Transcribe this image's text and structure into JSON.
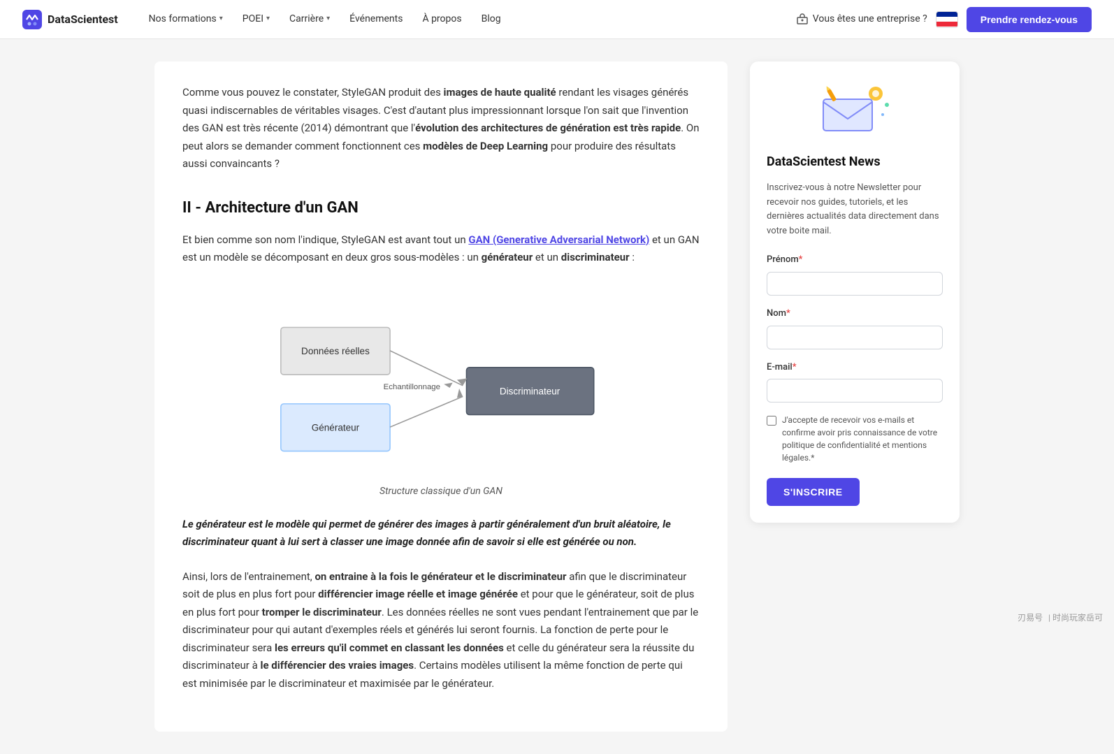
{
  "navbar": {
    "logo_text": "DataScientest",
    "nav_items": [
      {
        "label": "Nos formations",
        "has_dropdown": true
      },
      {
        "label": "POEI",
        "has_dropdown": true
      },
      {
        "label": "Carrière",
        "has_dropdown": true
      },
      {
        "label": "Événements",
        "has_dropdown": false
      },
      {
        "label": "À propos",
        "has_dropdown": false
      },
      {
        "label": "Blog",
        "has_dropdown": false
      }
    ],
    "enterprise_label": "Vous êtes une entreprise ?",
    "cta_label": "Prendre rendez-vous"
  },
  "article": {
    "intro_text_1": "Comme vous pouvez le constater, StyleGAN produit des ",
    "intro_bold_1": "images de haute qualité",
    "intro_text_2": " rendant les visages générés quasi indiscernables de véritables visages. C'est d'autant plus impressionnant lorsque l'on sait que l'invention des GAN est très récente (2014) démontrant que l'",
    "intro_bold_2": "évolution des architectures de génération est très rapide",
    "intro_text_3": ". On peut alors se demander comment fonctionnent ces ",
    "intro_bold_3": "modèles de Deep Learning",
    "intro_text_4": " pour produire des résultats aussi convaincants ?",
    "section_heading": "II - Architecture d'un GAN",
    "section_intro_1": "Et bien comme son nom l'indique, StyleGAN est avant tout un ",
    "section_link": "GAN (Generative Adversarial Network)",
    "section_intro_2": " et un GAN est un modèle se décomposant en deux gros sous-modèles : un ",
    "section_bold_1": "générateur",
    "section_intro_3": " et un ",
    "section_bold_2": "discriminateur",
    "section_intro_4": " :",
    "diagram_caption": "Structure classique d'un GAN",
    "diagram_labels": {
      "donnees_reelles": "Données réelles",
      "generateur": "Générateur",
      "echantillonnage": "Echantillonnage",
      "discriminateur": "Discriminateur"
    },
    "blockquote": "Le générateur est le modèle qui permet de générer des images à partir généralement d'un bruit aléatoire, le discriminateur quant à lui sert à classer une image donnée afin de savoir si elle est générée ou non.",
    "body_1": "Ainsi, lors de l'entrainement, ",
    "body_bold_1": "on entraine à la fois le générateur et le discriminateur",
    "body_2": " afin que le discriminateur soit de plus en plus fort pour ",
    "body_bold_2": "différencier image réelle et image générée",
    "body_3": " et pour que le générateur, soit de plus en plus fort pour ",
    "body_bold_3": "tromper le discriminateur",
    "body_4": ". Les données réelles ne sont vues pendant l'entrainement que par le discriminateur pour qui autant d'exemples réels et générés lui seront fournis. La fonction de perte pour le discriminateur sera ",
    "body_bold_4": "les erreurs qu'il commet en classant les données",
    "body_5": " et celle du générateur sera la réussite du discriminateur à ",
    "body_bold_5": "le différencier des vraies images",
    "body_6": ". Certains modèles utilisent la même fonction de perte qui est minimisée par le discriminateur et maximisée par le générateur."
  },
  "sidebar": {
    "title": "DataScientest News",
    "description": "Inscrivez-vous à notre Newsletter pour recevoir nos guides, tutoriels, et les dernières actualités data directement dans votre boite mail.",
    "form": {
      "prenom_label": "Prénom",
      "prenom_required": "*",
      "prenom_placeholder": "",
      "nom_label": "Nom",
      "nom_required": "*",
      "nom_placeholder": "",
      "email_label": "E-mail",
      "email_required": "*",
      "email_placeholder": "",
      "checkbox_text": "J'accepte de recevoir vos e-mails et confirme avoir pris connaissance de votre politique de confidentialité et mentions légales.",
      "checkbox_required": "*",
      "subscribe_label": "S'INSCRIRE"
    }
  },
  "watermark": {
    "text1": "刃易号",
    "text2": "| 时尚玩家岳可"
  }
}
